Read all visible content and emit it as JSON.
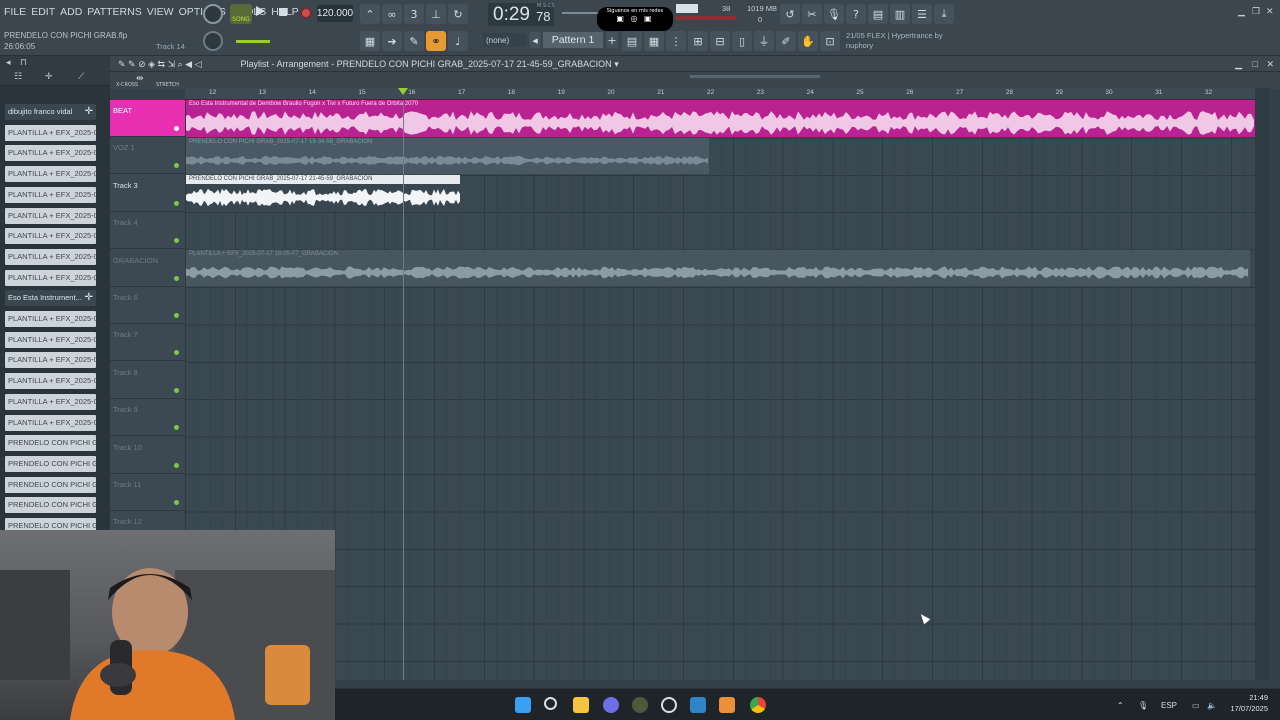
{
  "menu": [
    "FILE",
    "EDIT",
    "ADD",
    "PATTERNS",
    "VIEW",
    "OPTIONS",
    "TOOLS",
    "HELP"
  ],
  "project": {
    "filename": "PRENDELO CON PICHI GRAB.flp",
    "time": "26:06:05",
    "track_hint": "Track 14"
  },
  "transport": {
    "mode": "SONG",
    "tempo": "120.000",
    "time_main": "0:29",
    "time_sub": "78",
    "time_units": "M:S:CS"
  },
  "overlay_text": "Siguenos en mis redes",
  "meters": {
    "cpu": "38",
    "memory": "1019 MB",
    "voices": "0"
  },
  "pattern": {
    "snap": "(none)",
    "name": "Pattern 1"
  },
  "plugin_info": {
    "line1": "21/05  FLEX | Hypertrance by",
    "line2": "nuphory"
  },
  "playlist": {
    "title": "Playlist - Arrangement",
    "arrangement": "PRENDELO CON PICHI GRAB_2025-07-17 21-45-59_GRABACION"
  },
  "timeline_ticks": [
    "12",
    "13",
    "14",
    "15",
    "16",
    "17",
    "18",
    "19",
    "20",
    "21",
    "22",
    "23",
    "24",
    "25",
    "26",
    "27",
    "28",
    "29",
    "30",
    "31",
    "32"
  ],
  "toolbar_labels": {
    "crossfade": "X-CROSS",
    "stretch": "STRETCH"
  },
  "tracks": [
    {
      "label": "BEAT",
      "style": "beat"
    },
    {
      "label": "VOZ 1",
      "style": "dim"
    },
    {
      "label": "Track 3",
      "style": "lit"
    },
    {
      "label": "Track 4",
      "style": "dim"
    },
    {
      "label": "GRABACION",
      "style": "dim"
    },
    {
      "label": "Track 6",
      "style": "dim"
    },
    {
      "label": "Track 7",
      "style": "dim"
    },
    {
      "label": "Track 8",
      "style": "dim"
    },
    {
      "label": "Track 9",
      "style": "dim"
    },
    {
      "label": "Track 10",
      "style": "dim"
    },
    {
      "label": "Track 11",
      "style": "dim"
    },
    {
      "label": "Track 12",
      "style": "dim"
    }
  ],
  "clips": [
    {
      "label": "Eso Esta  Instrumental de Dembow  Braulio Fogon x Tivi x Futuro Fuera de Orbita 2070",
      "color": "#d42aa3"
    },
    {
      "label": "PRENDELO CON PICHI GRAB_2025-07-17 19-34-58_GRABACION",
      "color": "#50606b"
    },
    {
      "label": "PRENDELO CON PICHI GRAB_2025-07-17 21-45-59_GRABACION",
      "color": "#e6ebee"
    },
    {
      "label": "PLANTILLA + EFX_2025-07-17 18-05-07_GRABACION",
      "color": "#4e5d68"
    }
  ],
  "browser_items": [
    {
      "label": "dibujito franco vidal",
      "type": "audio"
    },
    {
      "label": "PLANTILLA + EFX_2025-0...",
      "type": "file"
    },
    {
      "label": "PLANTILLA + EFX_2025-0...",
      "type": "file"
    },
    {
      "label": "PLANTILLA + EFX_2025-0...",
      "type": "file"
    },
    {
      "label": "PLANTILLA + EFX_2025-0...",
      "type": "file"
    },
    {
      "label": "PLANTILLA + EFX_2025-0...",
      "type": "file"
    },
    {
      "label": "PLANTILLA + EFX_2025-0...",
      "type": "file"
    },
    {
      "label": "PLANTILLA + EFX_2025-0...",
      "type": "file"
    },
    {
      "label": "PLANTILLA + EFX_2025-0...",
      "type": "file"
    },
    {
      "label": "Eso Esta  Instrument...",
      "type": "audio"
    },
    {
      "label": "PLANTILLA + EFX_2025-0...",
      "type": "file"
    },
    {
      "label": "PLANTILLA + EFX_2025-0...",
      "type": "file"
    },
    {
      "label": "PLANTILLA + EFX_2025-0...",
      "type": "file"
    },
    {
      "label": "PLANTILLA + EFX_2025-0...",
      "type": "file"
    },
    {
      "label": "PLANTILLA + EFX_2025-0...",
      "type": "file"
    },
    {
      "label": "PLANTILLA + EFX_2025-07...",
      "type": "file"
    },
    {
      "label": "PRENDELO CON PICHI GRA...",
      "type": "file"
    },
    {
      "label": "PRENDELO CON PICHI GRA...",
      "type": "file"
    },
    {
      "label": "PRENDELO CON PICHI GRA...",
      "type": "file"
    },
    {
      "label": "PRENDELO CON PICHI GRA...",
      "type": "file"
    },
    {
      "label": "PRENDELO CON PICHI GRA...",
      "type": "file"
    }
  ],
  "taskbar": {
    "lang": "ESP",
    "time": "21:49",
    "date": "17/07/2025"
  }
}
